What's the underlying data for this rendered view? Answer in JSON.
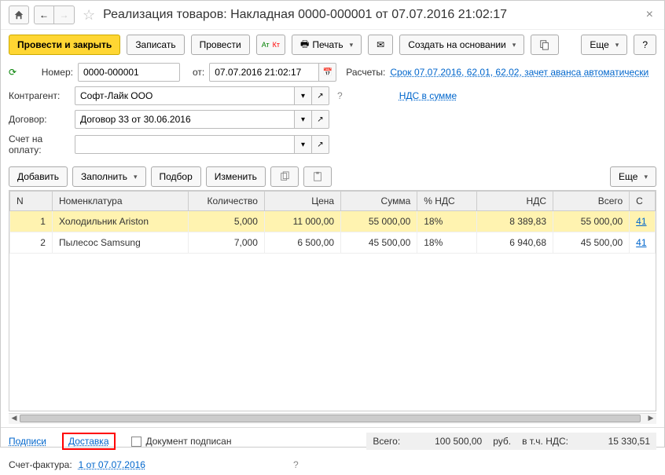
{
  "title": "Реализация товаров: Накладная 0000-000001 от 07.07.2016 21:02:17",
  "toolbar": {
    "post_close": "Провести и закрыть",
    "save": "Записать",
    "post": "Провести",
    "print": "Печать",
    "create_based": "Создать на основании",
    "more": "Еще"
  },
  "form": {
    "number_label": "Номер:",
    "number_value": "0000-000001",
    "from_label": "от:",
    "date_value": "07.07.2016 21:02:17",
    "calc_label": "Расчеты:",
    "calc_link": "Срок 07.07.2016, 62.01, 62.02, зачет аванса автоматически",
    "counterparty_label": "Контрагент:",
    "counterparty_value": "Софт-Лайк ООО",
    "vat_link": "НДС в сумме",
    "contract_label": "Договор:",
    "contract_value": "Договор 33 от 30.06.2016",
    "invoice_label": "Счет на оплату:"
  },
  "subtb": {
    "add": "Добавить",
    "fill": "Заполнить",
    "select": "Подбор",
    "change": "Изменить",
    "more": "Еще"
  },
  "table": {
    "headers": {
      "n": "N",
      "nomen": "Номенклатура",
      "qty": "Количество",
      "price": "Цена",
      "sum": "Сумма",
      "vat_pct": "% НДС",
      "vat": "НДС",
      "total": "Всего",
      "last": "С"
    },
    "rows": [
      {
        "n": "1",
        "nomen": "Холодильник Ariston",
        "qty": "5,000",
        "price": "11 000,00",
        "sum": "55 000,00",
        "vat_pct": "18%",
        "vat": "8 389,83",
        "total": "55 000,00",
        "last": "41"
      },
      {
        "n": "2",
        "nomen": "Пылесос Samsung",
        "qty": "7,000",
        "price": "6 500,00",
        "sum": "45 500,00",
        "vat_pct": "18%",
        "vat": "6 940,68",
        "total": "45 500,00",
        "last": "41"
      }
    ]
  },
  "footer": {
    "signatures": "Подписи",
    "delivery": "Доставка",
    "doc_signed": "Документ подписан",
    "total_label": "Всего:",
    "total_value": "100 500,00",
    "currency": "руб.",
    "vat_incl_label": "в т.ч. НДС:",
    "vat_incl_value": "15 330,51",
    "invoice_label": "Счет-фактура:",
    "invoice_link": "1 от 07.07.2016"
  }
}
